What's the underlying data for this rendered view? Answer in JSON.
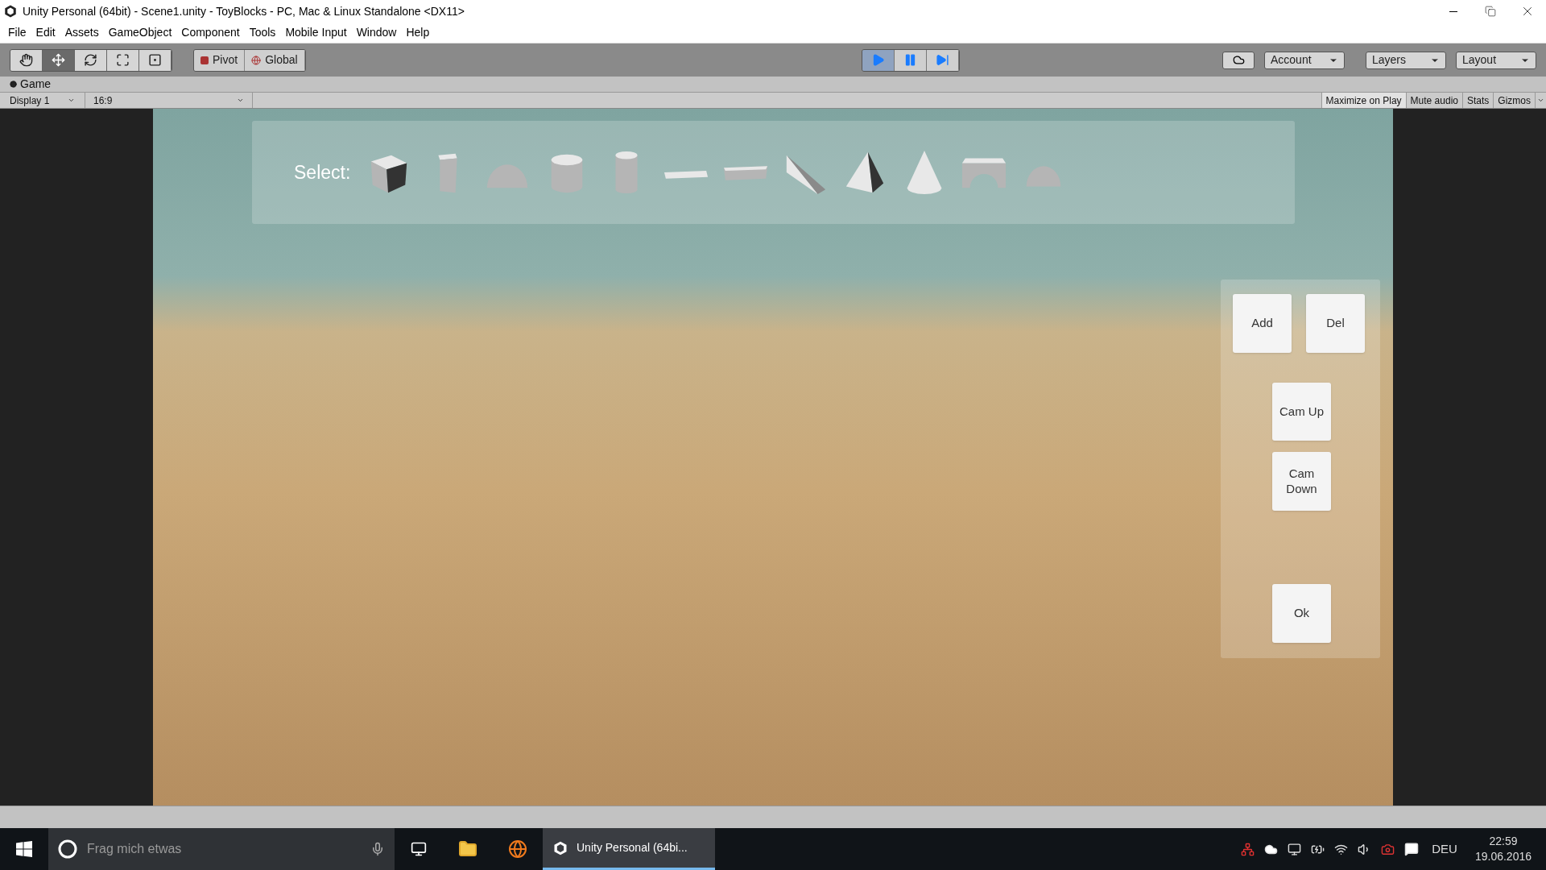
{
  "window": {
    "title": "Unity Personal (64bit) - Scene1.unity - ToyBlocks - PC, Mac & Linux Standalone <DX11>"
  },
  "menu": [
    "File",
    "Edit",
    "Assets",
    "GameObject",
    "Component",
    "Tools",
    "Mobile Input",
    "Window",
    "Help"
  ],
  "tools": [
    {
      "kind": "hand",
      "selected": false
    },
    {
      "kind": "move",
      "selected": true
    },
    {
      "kind": "rotate",
      "selected": false
    },
    {
      "kind": "scale",
      "selected": false
    },
    {
      "kind": "rect",
      "selected": false
    }
  ],
  "pivot_buttons": [
    "Pivot",
    "Global"
  ],
  "play_controls": [
    {
      "kind": "play",
      "on": true
    },
    {
      "kind": "pause",
      "on": false
    },
    {
      "kind": "step",
      "on": false
    }
  ],
  "right_dropdowns": [
    "Account",
    "Layers",
    "Layout"
  ],
  "game_tab": {
    "title": "Game",
    "display": "Display 1",
    "aspect": "16:9",
    "toggles": [
      {
        "label": "Maximize on Play",
        "on": true
      },
      {
        "label": "Mute audio",
        "on": false
      },
      {
        "label": "Stats",
        "on": false
      },
      {
        "label": "Gizmos",
        "on": false
      }
    ]
  },
  "game_ui": {
    "select_label": "Select:",
    "shapes": [
      {
        "kind": "cube"
      },
      {
        "kind": "block"
      },
      {
        "kind": "half-cylinder"
      },
      {
        "kind": "cylinder"
      },
      {
        "kind": "tall-cylinder"
      },
      {
        "kind": "plank"
      },
      {
        "kind": "slab"
      },
      {
        "kind": "wedge"
      },
      {
        "kind": "pyramid"
      },
      {
        "kind": "cone"
      },
      {
        "kind": "arch"
      },
      {
        "kind": "dome"
      }
    ],
    "buttons": [
      {
        "label": "Add"
      },
      {
        "label": "Del"
      },
      {
        "label": "Cam Up"
      },
      {
        "label": "Cam Down"
      },
      {
        "label": "Ok"
      }
    ]
  },
  "taskbar": {
    "search_placeholder": "Frag mich etwas",
    "active_app": "Unity Personal (64bi...",
    "language": "DEU",
    "time": "22:59",
    "date": "19.06.2016"
  }
}
